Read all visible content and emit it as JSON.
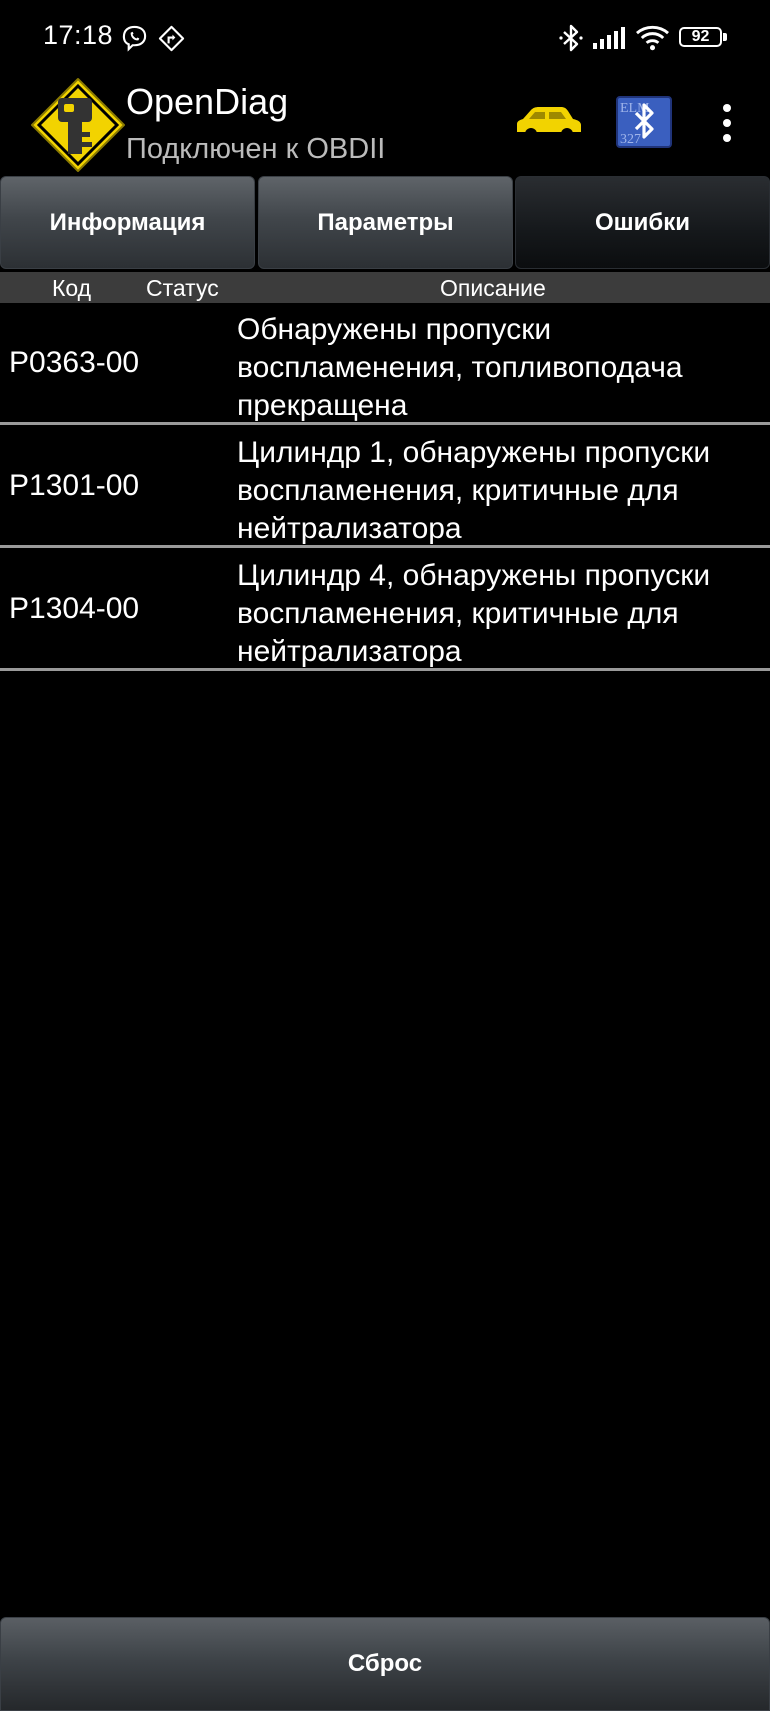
{
  "status_bar": {
    "time": "17:18",
    "battery": "92",
    "icons": [
      "viber-icon",
      "navigation-icon",
      "bluetooth-icon",
      "signal-icon",
      "wifi-icon",
      "battery-icon"
    ]
  },
  "app_bar": {
    "title": "OpenDiag",
    "subtitle": "Подключен к OBDII",
    "logo_icon": "key-warning-sign-icon",
    "actions": [
      "car-icon",
      "bluetooth-elm-icon",
      "more-vert-icon"
    ],
    "accent_color": "#f2d300"
  },
  "tabs": [
    {
      "label": "Информация",
      "active": false
    },
    {
      "label": "Параметры",
      "active": false
    },
    {
      "label": "Ошибки",
      "active": true
    }
  ],
  "table": {
    "headers": {
      "code": "Код",
      "status": "Статус",
      "description": "Описание"
    },
    "rows": [
      {
        "code": "P0363-00",
        "status": "",
        "description": "Обнаружены пропуски воспламенения, топливоподача прекращена"
      },
      {
        "code": "P1301-00",
        "status": "",
        "description": "Цилиндр 1, обнаружены пропуски воспламенения, критичные для нейтрализатора"
      },
      {
        "code": "P1304-00",
        "status": "",
        "description": "Цилиндр 4, обнаружены пропуски воспламенения, критичные для нейтрализатора"
      }
    ]
  },
  "footer": {
    "reset_label": "Сброс"
  }
}
